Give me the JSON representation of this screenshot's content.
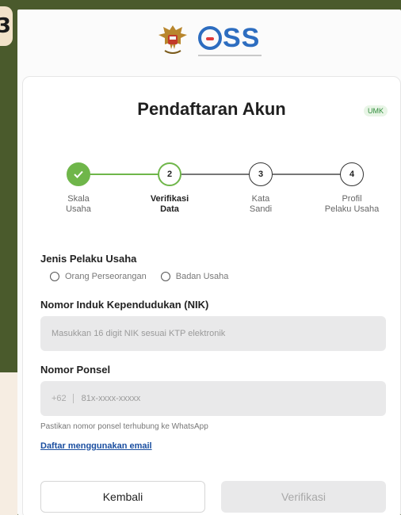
{
  "overlay": {
    "step_number": "3"
  },
  "header": {
    "logo_text": "SS"
  },
  "card": {
    "title": "Pendaftaran Akun",
    "badge": "UMK"
  },
  "steps": [
    {
      "number": "",
      "label": "Skala\nUsaha",
      "status": "done"
    },
    {
      "number": "2",
      "label": "Verifikasi\nData",
      "status": "active"
    },
    {
      "number": "3",
      "label": "Kata\nSandi",
      "status": "pending"
    },
    {
      "number": "4",
      "label": "Profil\nPelaku Usaha",
      "status": "pending"
    }
  ],
  "jenis": {
    "label": "Jenis Pelaku Usaha",
    "options": [
      "Orang Perseorangan",
      "Badan Usaha"
    ]
  },
  "nik": {
    "label": "Nomor Induk Kependudukan (NIK)",
    "placeholder": "Masukkan 16 digit NIK sesuai KTP elektronik"
  },
  "phone": {
    "label": "Nomor Ponsel",
    "prefix": "+62",
    "placeholder": "81x-xxxx-xxxxx",
    "hint": "Pastikan nomor ponsel terhubung ke WhatsApp"
  },
  "email_link": "Daftar menggunakan email",
  "buttons": {
    "back": "Kembali",
    "verify": "Verifikasi"
  },
  "colors": {
    "brand_blue": "#2d6dc0",
    "green": "#6fb64a",
    "background": "#4a5a2c"
  }
}
